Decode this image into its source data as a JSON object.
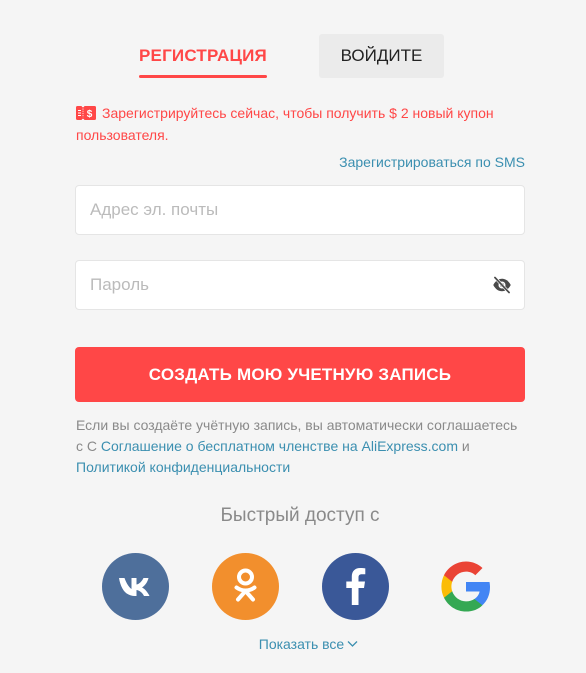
{
  "tabs": {
    "register_label": "РЕГИСТРАЦИЯ",
    "login_label": "ВОЙДИТЕ"
  },
  "promo": {
    "icon": "coupon-icon",
    "text": "Зарегистрируйтесь сейчас, чтобы получить $ 2 новый купон пользователя."
  },
  "sms_link": "Зарегистрироваться по SMS",
  "form": {
    "email_placeholder": "Адрес эл. почты",
    "email_value": "",
    "password_placeholder": "Пароль",
    "password_value": "",
    "submit_label": "СОЗДАТЬ МОЮ УЧЕТНУЮ ЗАПИСЬ"
  },
  "terms": {
    "prefix": "Если вы создаёте учётную запись, вы автоматически соглашаетесь с С ",
    "agreement_link": "Соглашение о бесплатном членстве на AliExpress.com",
    "conjunction": " и ",
    "privacy_link": "Политикой конфиденциальности"
  },
  "quick_access": {
    "title": "Быстрый доступ с",
    "providers": [
      "vk-icon",
      "odnoklassniki-icon",
      "facebook-icon",
      "google-icon"
    ],
    "show_all": "Показать все"
  },
  "colors": {
    "accent": "#ff4747",
    "link": "#3b8fb0",
    "vk": "#4e6f9b",
    "ok": "#f28f2d",
    "facebook": "#3a5898"
  }
}
